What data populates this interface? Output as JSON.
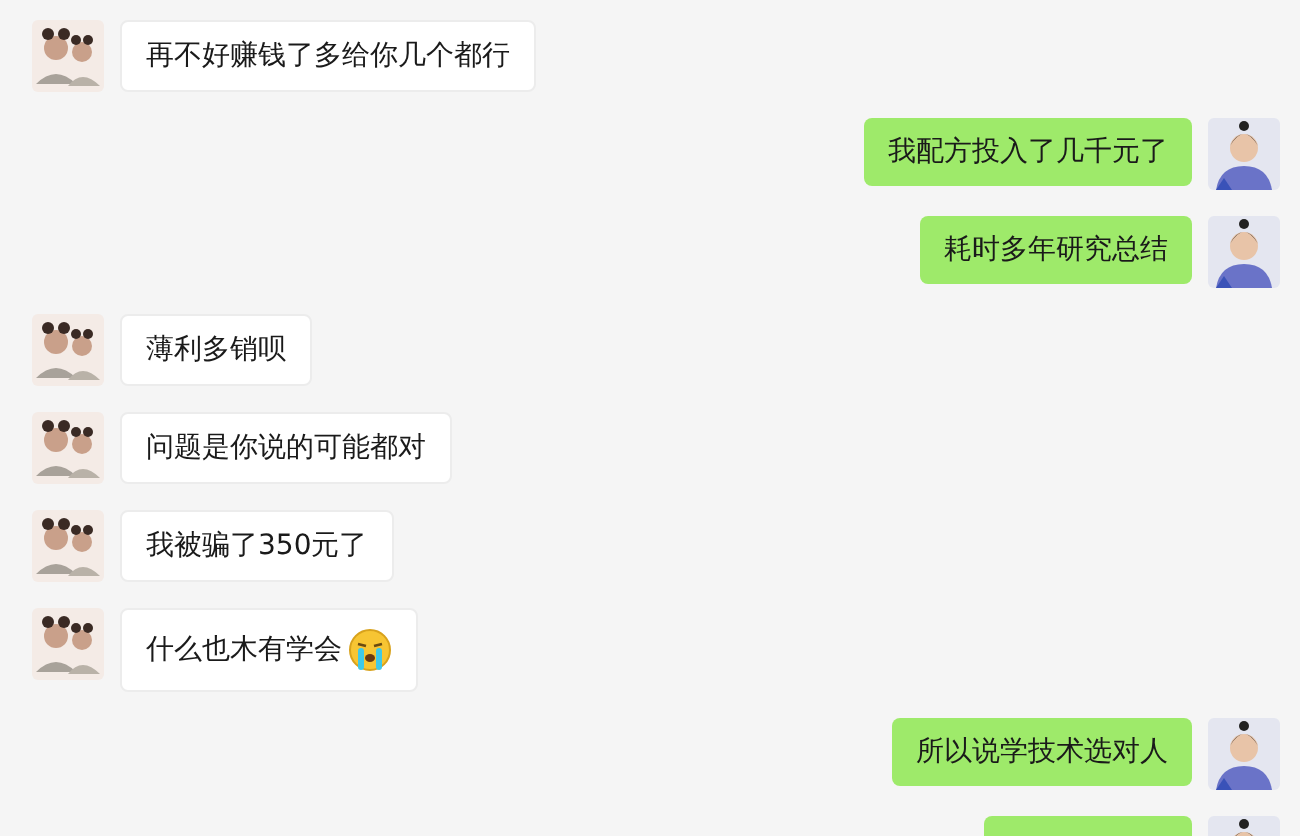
{
  "messages": [
    {
      "outgoing": false,
      "kind": "text",
      "text": "再不好赚钱了多给你几个都行"
    },
    {
      "outgoing": true,
      "kind": "text",
      "text": "我配方投入了几千元了"
    },
    {
      "outgoing": true,
      "kind": "text",
      "text": "耗时多年研究总结"
    },
    {
      "outgoing": false,
      "kind": "text",
      "text": "薄利多销呗"
    },
    {
      "outgoing": false,
      "kind": "text",
      "text": "问题是你说的可能都对"
    },
    {
      "outgoing": false,
      "kind": "text",
      "text": "我被骗了350元了"
    },
    {
      "outgoing": false,
      "kind": "emoji",
      "text": "什么也木有学会"
    },
    {
      "outgoing": true,
      "kind": "text",
      "text": "所以说学技术选对人"
    },
    {
      "outgoing": true,
      "kind": "text"
    }
  ]
}
